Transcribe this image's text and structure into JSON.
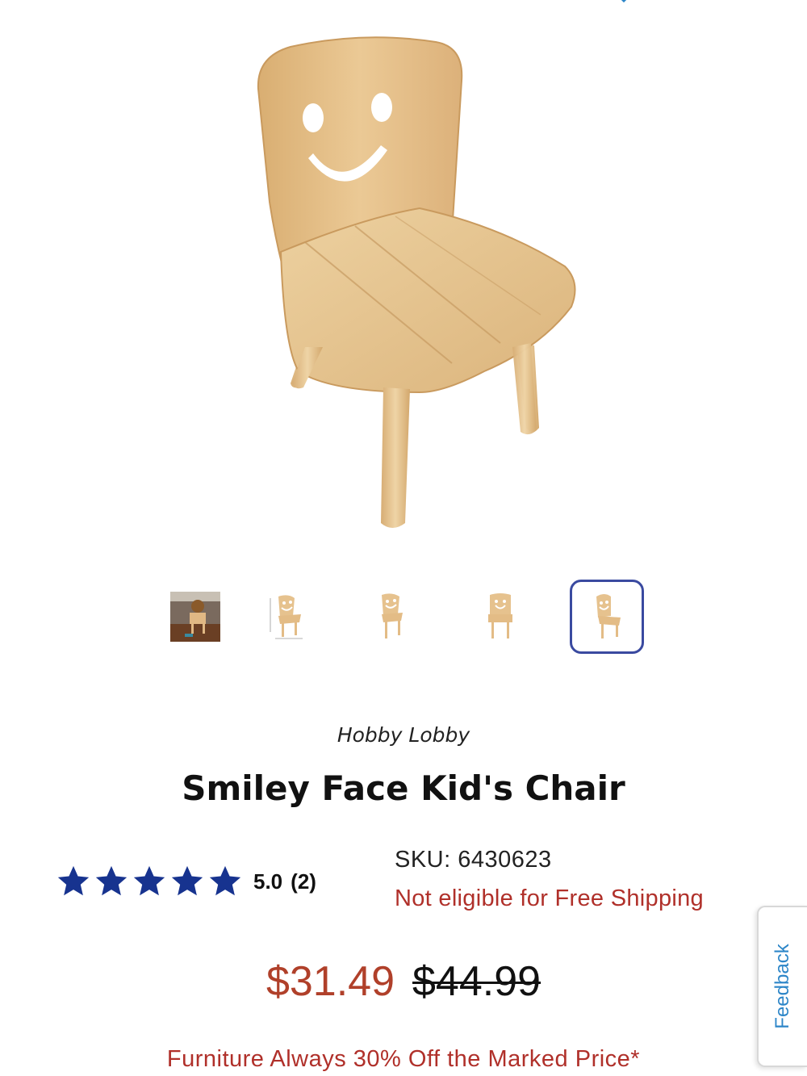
{
  "gallery": {
    "hero_alt": "Smiley Face Kid's Chair main image",
    "selected_index": 4,
    "thumbnails": [
      {
        "name": "thumb-lifestyle"
      },
      {
        "name": "thumb-dimensions"
      },
      {
        "name": "thumb-angle-left"
      },
      {
        "name": "thumb-front"
      },
      {
        "name": "thumb-angle-right"
      }
    ]
  },
  "product": {
    "vendor": "Hobby Lobby",
    "title": "Smiley Face Kid's Chair",
    "rating_value": "5.0",
    "rating_count": "(2)",
    "rating_stars": 5,
    "sku": "SKU: 6430623",
    "shipping_note": "Not eligible for Free Shipping",
    "sale_price": "$31.49",
    "original_price": "$44.99",
    "promo": "Furniture Always 30% Off the Marked Price*"
  },
  "feedback_tab": {
    "label": "Feedback"
  },
  "colors": {
    "accent_red": "#b0302a",
    "star_blue": "#17338f",
    "selected_border": "#3a4aa0",
    "feedback_blue": "#2d86c8",
    "wood": "#e2bd86"
  },
  "icons": {
    "star": "star-icon",
    "scroll_indicator": "chevron-down-icon"
  }
}
